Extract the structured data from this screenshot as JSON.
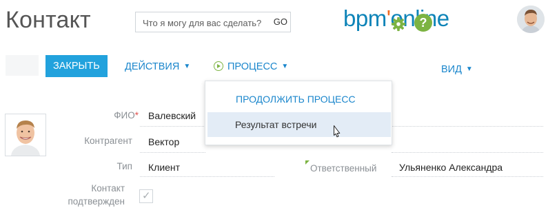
{
  "header": {
    "title": "Контакт",
    "search": {
      "placeholder": "Что я могу для вас сделать?",
      "go_label": "GO"
    },
    "logo": {
      "prefix": "bpm",
      "accent": "'",
      "suffix": "online"
    }
  },
  "toolbar": {
    "close_label": "ЗАКРЫТЬ",
    "actions_label": "ДЕЙСТВИЯ",
    "process_label": "ПРОЦЕСС",
    "view_label": "ВИД"
  },
  "process_menu": {
    "header": "ПРОДОЛЖИТЬ ПРОЦЕСС",
    "item": "Результат встречи"
  },
  "form": {
    "name": {
      "label": "ФИО",
      "required_mark": "*",
      "value": "Валевский"
    },
    "account": {
      "label": "Контрагент",
      "value": "Вектор"
    },
    "type": {
      "label": "Тип",
      "value": "Клиент"
    },
    "owner": {
      "label": "Ответственный",
      "value": "Ульяненко Александра"
    },
    "confirmed": {
      "label_line1": "Контакт",
      "label_line2": "подтвержден",
      "checked": true
    }
  },
  "colors": {
    "accent_blue": "#22a2dd",
    "link_blue": "#1a86cc",
    "green": "#7cb342",
    "logo_orange": "#f06b22"
  }
}
